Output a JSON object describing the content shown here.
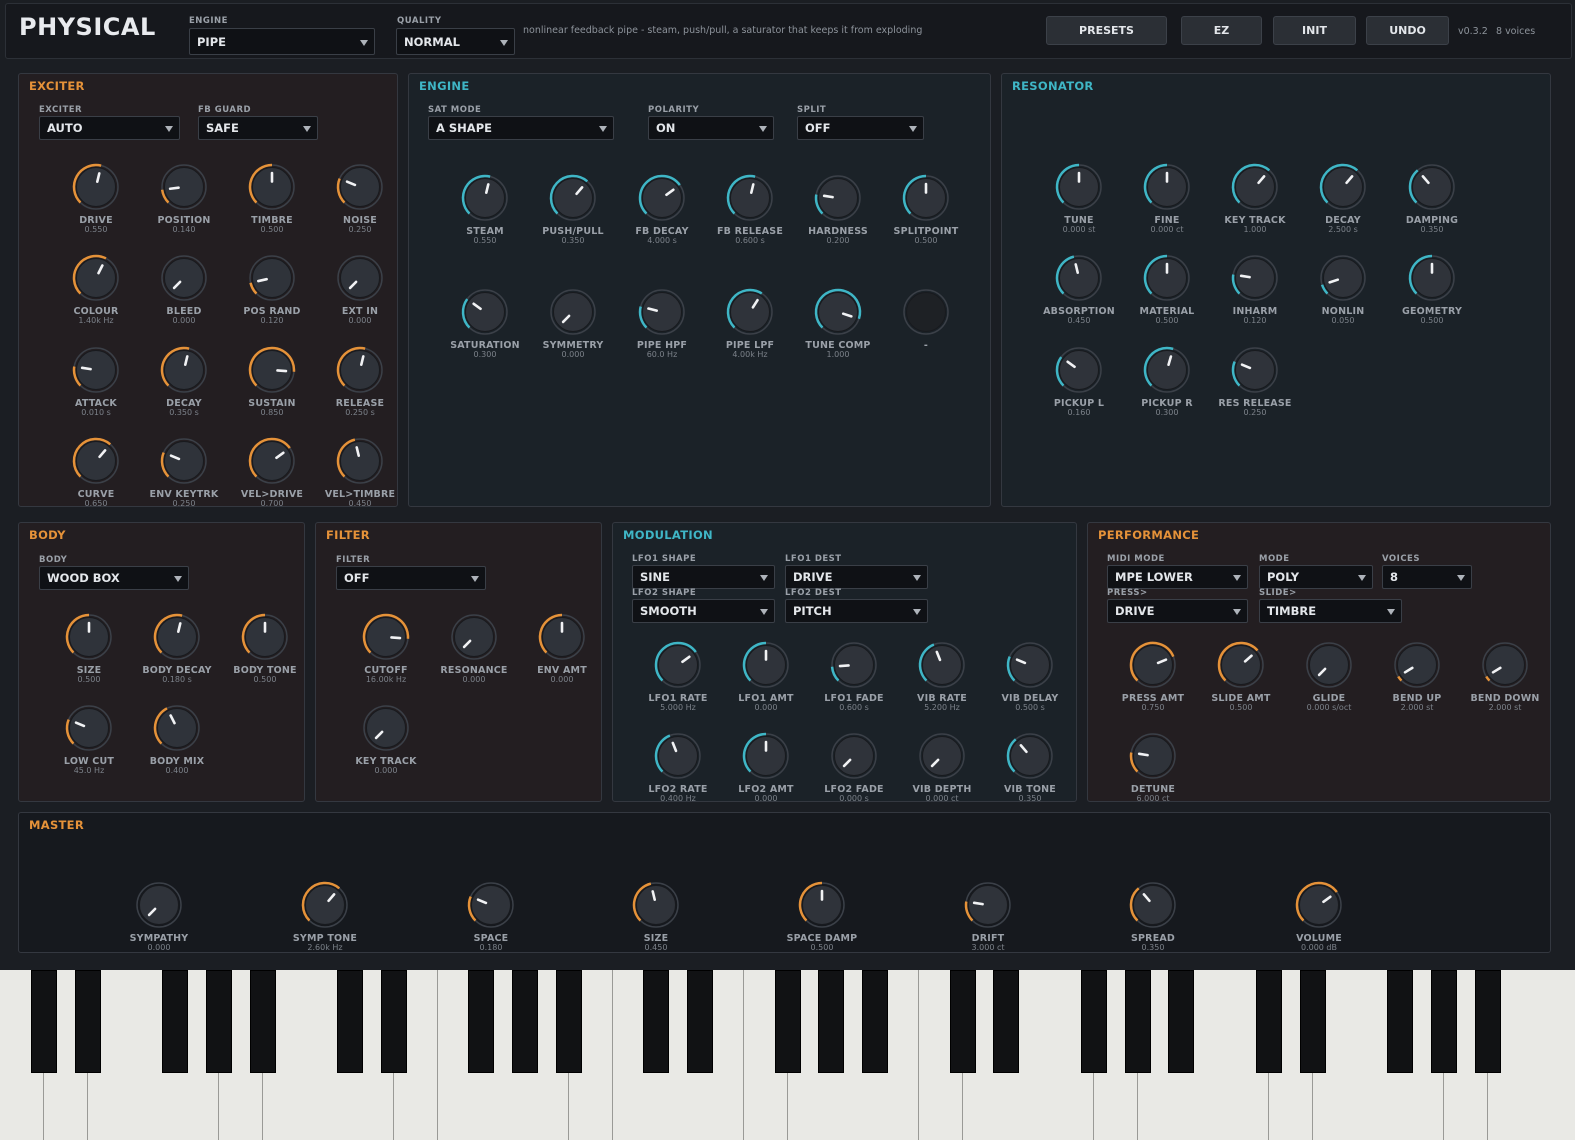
{
  "header": {
    "title": "PHYSICAL",
    "engine_label": "ENGINE",
    "engine_value": "PIPE",
    "quality_label": "QUALITY",
    "quality_value": "NORMAL",
    "description": "nonlinear feedback pipe - steam, push/pull, a saturator that keeps it from exploding",
    "buttons": {
      "presets": "PRESETS",
      "ez": "EZ",
      "init": "INIT",
      "undo": "UNDO"
    },
    "version": "v0.3.2",
    "voices": "8 voices"
  },
  "colors": {
    "warm_accent": "#e59239",
    "cool_accent": "#3fb6c6"
  },
  "exciter": {
    "title": "EXCITER",
    "dropdowns": [
      {
        "label": "EXCITER",
        "value": "AUTO"
      },
      {
        "label": "FB GUARD",
        "value": "SAFE"
      }
    ],
    "knobs": [
      {
        "label": "DRIVE",
        "value": "0.550",
        "norm": 0.55
      },
      {
        "label": "POSITION",
        "value": "0.140",
        "norm": 0.14
      },
      {
        "label": "TIMBRE",
        "value": "0.500",
        "norm": 0.5
      },
      {
        "label": "NOISE",
        "value": "0.250",
        "norm": 0.25
      },
      {
        "label": "COLOUR",
        "value": "1.40k Hz",
        "norm": 0.6
      },
      {
        "label": "BLEED",
        "value": "0.000",
        "norm": 0
      },
      {
        "label": "POS RAND",
        "value": "0.120",
        "norm": 0.12
      },
      {
        "label": "EXT IN",
        "value": "0.000",
        "norm": 0
      },
      {
        "label": "ATTACK",
        "value": "0.010 s",
        "norm": 0.2
      },
      {
        "label": "DECAY",
        "value": "0.350 s",
        "norm": 0.55
      },
      {
        "label": "SUSTAIN",
        "value": "0.850",
        "norm": 0.85
      },
      {
        "label": "RELEASE",
        "value": "0.250 s",
        "norm": 0.55
      },
      {
        "label": "CURVE",
        "value": "0.650",
        "norm": 0.65
      },
      {
        "label": "ENV KEYTRK",
        "value": "0.250",
        "norm": 0.25
      },
      {
        "label": "VEL>DRIVE",
        "value": "0.700",
        "norm": 0.7
      },
      {
        "label": "VEL>TIMBRE",
        "value": "0.450",
        "norm": 0.45
      }
    ]
  },
  "engine": {
    "title": "ENGINE",
    "dropdowns": [
      {
        "label": "SAT MODE",
        "value": "A SHAPE"
      },
      {
        "label": "POLARITY",
        "value": "ON"
      },
      {
        "label": "SPLIT",
        "value": "OFF"
      }
    ],
    "knobs": [
      {
        "label": "STEAM",
        "value": "0.550",
        "norm": 0.55
      },
      {
        "label": "PUSH/PULL",
        "value": "0.350",
        "norm": 0.65
      },
      {
        "label": "FB DECAY",
        "value": "4.000 s",
        "norm": 0.7
      },
      {
        "label": "FB RELEASE",
        "value": "0.600 s",
        "norm": 0.55
      },
      {
        "label": "HARDNESS",
        "value": "0.200",
        "norm": 0.2
      },
      {
        "label": "SPLITPOINT",
        "value": "0.500",
        "norm": 0.5
      },
      {
        "label": "SATURATION",
        "value": "0.300",
        "norm": 0.3
      },
      {
        "label": "SYMMETRY",
        "value": "0.000",
        "norm": 0
      },
      {
        "label": "PIPE HPF",
        "value": "60.0 Hz",
        "norm": 0.22
      },
      {
        "label": "PIPE LPF",
        "value": "4.00k Hz",
        "norm": 0.62
      },
      {
        "label": "TUNE COMP",
        "value": "1.000",
        "norm": 0.9
      },
      {
        "label": "-",
        "value": "",
        "norm": 0,
        "disabled": true
      }
    ]
  },
  "resonator": {
    "title": "RESONATOR",
    "knobs": [
      {
        "label": "TUNE",
        "value": "0.000 st",
        "norm": 0.5
      },
      {
        "label": "FINE",
        "value": "0.000 ct",
        "norm": 0.5
      },
      {
        "label": "KEY TRACK",
        "value": "1.000",
        "norm": 0.65
      },
      {
        "label": "DECAY",
        "value": "2.500 s",
        "norm": 0.65
      },
      {
        "label": "DAMPING",
        "value": "0.350",
        "norm": 0.35
      },
      {
        "label": "ABSORPTION",
        "value": "0.450",
        "norm": 0.45
      },
      {
        "label": "MATERIAL",
        "value": "0.500",
        "norm": 0.5
      },
      {
        "label": "INHARM",
        "value": "0.120",
        "norm": 0.2
      },
      {
        "label": "NONLIN",
        "value": "0.050",
        "norm": 0.1
      },
      {
        "label": "GEOMETRY",
        "value": "0.500",
        "norm": 0.5
      },
      {
        "label": "PICKUP L",
        "value": "0.160",
        "norm": 0.3
      },
      {
        "label": "PICKUP R",
        "value": "0.300",
        "norm": 0.56
      },
      {
        "label": "RES RELEASE",
        "value": "0.250",
        "norm": 0.25
      }
    ]
  },
  "body_section": {
    "title": "BODY",
    "dropdowns": [
      {
        "label": "BODY",
        "value": "WOOD BOX"
      }
    ],
    "knobs": [
      {
        "label": "SIZE",
        "value": "0.500",
        "norm": 0.5
      },
      {
        "label": "BODY DECAY",
        "value": "0.180 s",
        "norm": 0.55
      },
      {
        "label": "BODY TONE",
        "value": "0.500",
        "norm": 0.5
      },
      {
        "label": "LOW CUT",
        "value": "45.0 Hz",
        "norm": 0.25
      },
      {
        "label": "BODY MIX",
        "value": "0.400",
        "norm": 0.4
      }
    ]
  },
  "filter": {
    "title": "FILTER",
    "dropdowns": [
      {
        "label": "FILTER",
        "value": "OFF"
      }
    ],
    "knobs": [
      {
        "label": "CUTOFF",
        "value": "16.00k Hz",
        "norm": 0.85
      },
      {
        "label": "RESONANCE",
        "value": "0.000",
        "norm": 0
      },
      {
        "label": "ENV AMT",
        "value": "0.000",
        "norm": 0.5
      },
      {
        "label": "KEY TRACK",
        "value": "0.000",
        "norm": 0
      }
    ]
  },
  "modulation": {
    "title": "MODULATION",
    "dropdowns": [
      {
        "label": "LFO1 SHAPE",
        "value": "SINE"
      },
      {
        "label": "LFO1 DEST",
        "value": "DRIVE"
      },
      {
        "label": "LFO2 SHAPE",
        "value": "SMOOTH"
      },
      {
        "label": "LFO2 DEST",
        "value": "PITCH"
      }
    ],
    "knobs": [
      {
        "label": "LFO1 RATE",
        "value": "5.000 Hz",
        "norm": 0.7
      },
      {
        "label": "LFO1 AMT",
        "value": "0.000",
        "norm": 0.5
      },
      {
        "label": "LFO1 FADE",
        "value": "0.600 s",
        "norm": 0.15
      },
      {
        "label": "VIB RATE",
        "value": "5.200 Hz",
        "norm": 0.42
      },
      {
        "label": "VIB DELAY",
        "value": "0.500 s",
        "norm": 0.25
      },
      {
        "label": "LFO2 RATE",
        "value": "0.400 Hz",
        "norm": 0.42
      },
      {
        "label": "LFO2 AMT",
        "value": "0.000",
        "norm": 0.5
      },
      {
        "label": "LFO2 FADE",
        "value": "0.000 s",
        "norm": 0
      },
      {
        "label": "VIB DEPTH",
        "value": "0.000 ct",
        "norm": 0
      },
      {
        "label": "VIB TONE",
        "value": "0.350",
        "norm": 0.35
      }
    ]
  },
  "performance": {
    "title": "PERFORMANCE",
    "dropdowns": [
      {
        "label": "MIDI MODE",
        "value": "MPE LOWER"
      },
      {
        "label": "MODE",
        "value": "POLY"
      },
      {
        "label": "VOICES",
        "value": "8"
      },
      {
        "label": "PRESS>",
        "value": "DRIVE"
      },
      {
        "label": "SLIDE>",
        "value": "TIMBRE"
      }
    ],
    "knobs": [
      {
        "label": "PRESS AMT",
        "value": "0.750",
        "norm": 0.75
      },
      {
        "label": "SLIDE AMT",
        "value": "0.500",
        "norm": 0.68
      },
      {
        "label": "GLIDE",
        "value": "0.000 s/oct",
        "norm": 0
      },
      {
        "label": "BEND UP",
        "value": "2.000 st",
        "norm": 0.05
      },
      {
        "label": "BEND DOWN",
        "value": "2.000 st",
        "norm": 0.05
      },
      {
        "label": "DETUNE",
        "value": "6.000 ct",
        "norm": 0.2
      }
    ]
  },
  "master": {
    "title": "MASTER",
    "knobs": [
      {
        "label": "SYMPATHY",
        "value": "0.000",
        "norm": 0
      },
      {
        "label": "SYMP TONE",
        "value": "2.60k Hz",
        "norm": 0.65
      },
      {
        "label": "SPACE",
        "value": "0.180",
        "norm": 0.25
      },
      {
        "label": "SIZE",
        "value": "0.450",
        "norm": 0.45
      },
      {
        "label": "SPACE DAMP",
        "value": "0.500",
        "norm": 0.5
      },
      {
        "label": "DRIFT",
        "value": "3.000 ct",
        "norm": 0.2
      },
      {
        "label": "SPREAD",
        "value": "0.350",
        "norm": 0.35
      },
      {
        "label": "VOLUME",
        "value": "0.000 dB",
        "norm": 0.7
      }
    ]
  }
}
